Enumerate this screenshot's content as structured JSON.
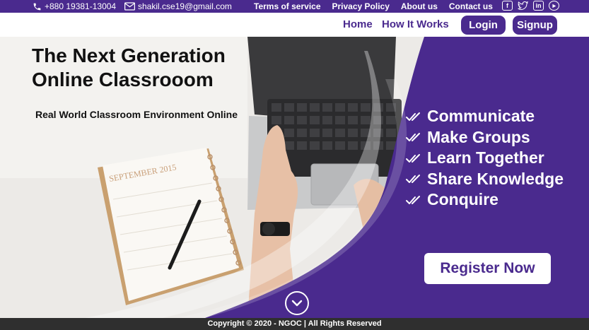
{
  "topbar": {
    "phone": "+880 19381-13004",
    "email": "shakil.cse19@gmail.com",
    "links": [
      "Terms of service",
      "Privacy Policy",
      "About us",
      "Contact us"
    ],
    "socials": [
      "facebook-icon",
      "twitter-icon",
      "linkedin-icon",
      "youtube-icon"
    ]
  },
  "nav": {
    "home": "Home",
    "how_it_works": "How It Works",
    "login": "Login",
    "signup": "Signup"
  },
  "hero": {
    "title_line1": "The Next Generation",
    "title_line2": "Online Classrooom",
    "subtitle": "Real World Classroom Environment Online",
    "features": [
      "Communicate",
      "Make Groups",
      "Learn Together",
      "Share Knowledge",
      "Conquire"
    ],
    "register": "Register Now",
    "calendar_text": "SEPTEMBER 2015"
  },
  "footer": {
    "copyright": "Copyright © 2020 - NGOC | All Rights Reserved"
  },
  "colors": {
    "brand": "#4a2a8e",
    "footer": "#2f2f2f"
  }
}
